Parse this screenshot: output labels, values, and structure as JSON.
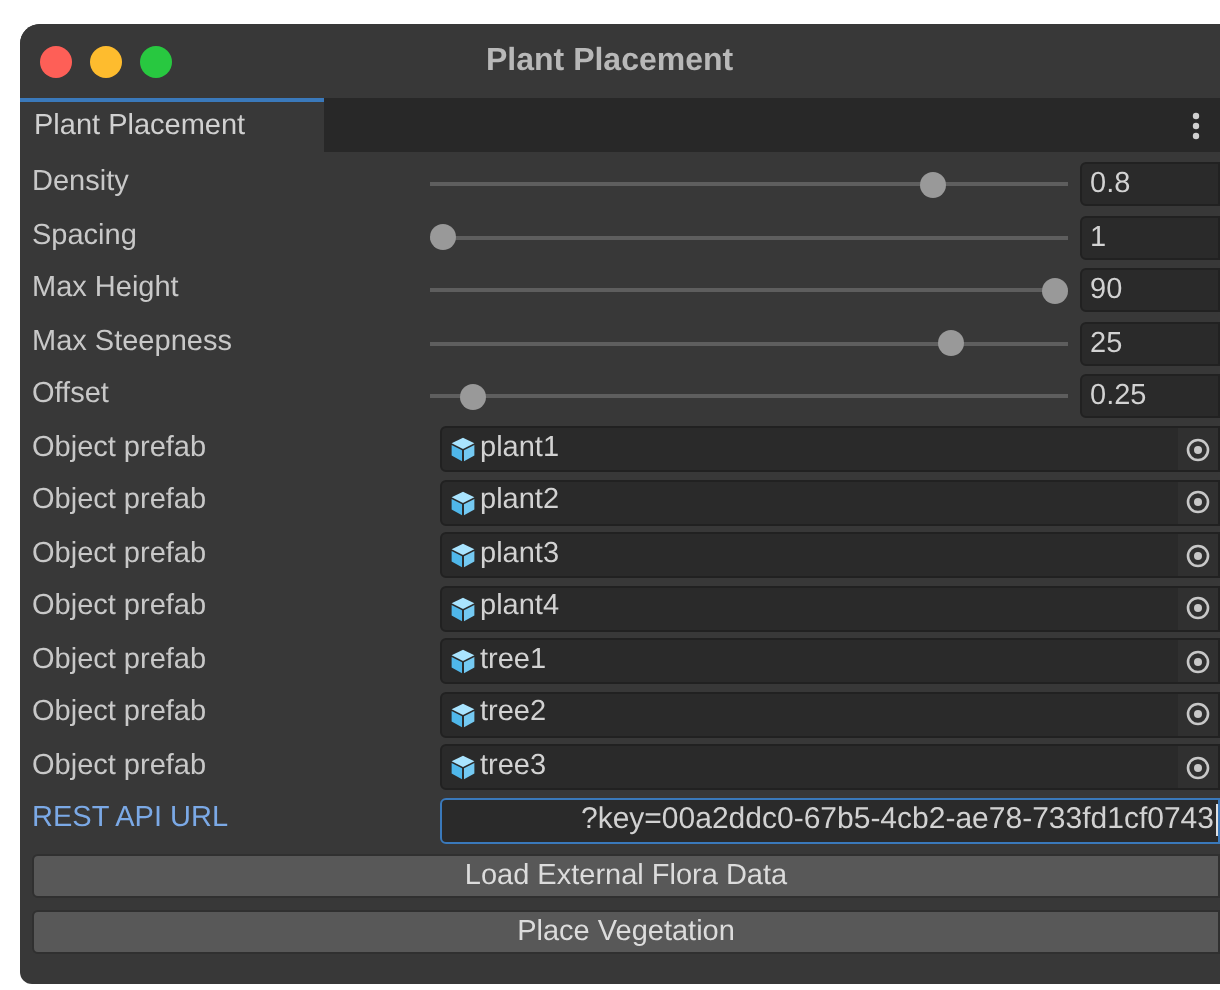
{
  "window": {
    "title": "Plant Placement"
  },
  "tabs": [
    {
      "label": "Plant Placement",
      "selected": true
    }
  ],
  "sliders": [
    {
      "label": "Density",
      "level": 0.8,
      "value": "0.8"
    },
    {
      "label": "Spacing",
      "level": 0,
      "value": "1"
    },
    {
      "label": "Max Height",
      "level": 1,
      "value": "90"
    },
    {
      "label": "Max Steepness",
      "level": 0.83,
      "value": "25"
    },
    {
      "label": "Offset",
      "level": 0.05,
      "value": "0.25"
    }
  ],
  "prefabs": [
    {
      "label": "Object prefab",
      "value": "plant1"
    },
    {
      "label": "Object prefab",
      "value": "plant2"
    },
    {
      "label": "Object prefab",
      "value": "plant3"
    },
    {
      "label": "Object prefab",
      "value": "plant4"
    },
    {
      "label": "Object prefab",
      "value": "tree1"
    },
    {
      "label": "Object prefab",
      "value": "tree2"
    },
    {
      "label": "Object prefab",
      "value": "tree3"
    }
  ],
  "url_field": {
    "label": "REST API URL",
    "value": "?key=00a2ddc0-67b5-4cb2-ae78-733fd1cf0743",
    "focused": true
  },
  "buttons": [
    "Load External Flora Data",
    "Place Vegetation"
  ]
}
